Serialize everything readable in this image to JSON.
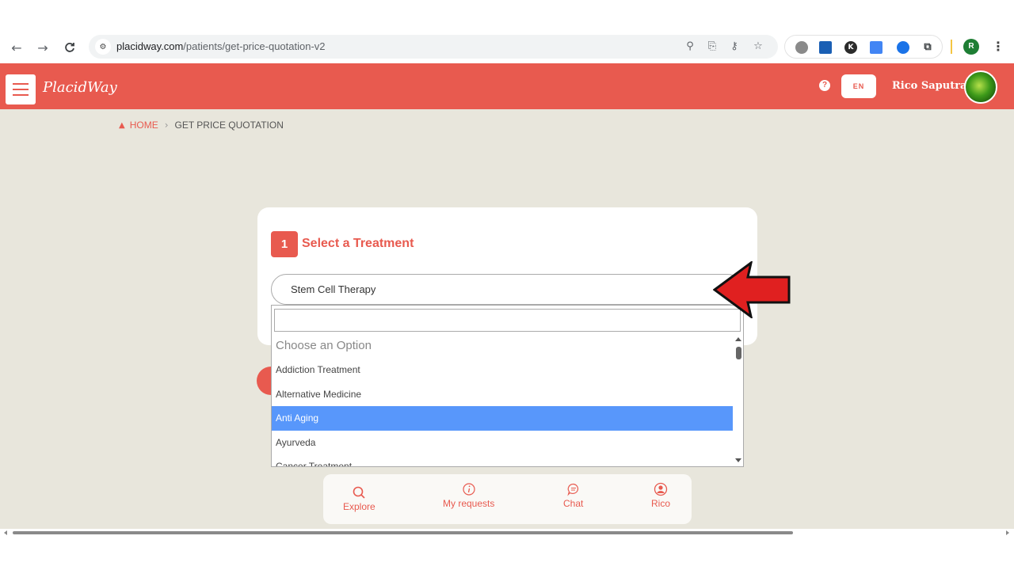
{
  "browser": {
    "url_host": "placidway.com",
    "url_path": "/patients/get-price-quotation-v2",
    "profile_initial": "R",
    "extensions": [
      {
        "name": "globe-extension-icon",
        "color": "#8a8a8a",
        "label": ""
      },
      {
        "name": "pen-extension-icon",
        "color": "#1a5fb4",
        "label": ""
      },
      {
        "name": "k-extension-icon",
        "color": "#2b2b2b",
        "label": "K"
      },
      {
        "name": "translate-extension-icon",
        "color": "#4285f4",
        "label": ""
      },
      {
        "name": "triangle-extension-icon",
        "color": "#1a73e8",
        "label": ""
      },
      {
        "name": "puzzle-extension-icon",
        "color": "#5f6368",
        "label": ""
      }
    ]
  },
  "header": {
    "logo_text": "PlacidWay",
    "lang": "EN",
    "user_name": "Rico Saputra",
    "brand_color": "#e85a4f"
  },
  "breadcrumb": {
    "home": "HOME",
    "current": "GET PRICE QUOTATION"
  },
  "form": {
    "step_number": "1",
    "step_title": "Select a Treatment",
    "selected_value": "Stem Cell Therapy",
    "dropdown": {
      "search_value": "",
      "options": [
        "Choose an Option",
        "Addiction Treatment",
        "Alternative Medicine",
        "Anti Aging",
        "Ayurveda",
        "Cancer Treatment"
      ],
      "highlighted": "Anti Aging"
    }
  },
  "bottom_nav": {
    "items": [
      {
        "label": "Explore",
        "icon": "search-icon"
      },
      {
        "label": "My requests",
        "icon": "info-icon"
      },
      {
        "label": "Chat",
        "icon": "chat-icon"
      },
      {
        "label": "Rico",
        "icon": "user-icon"
      }
    ]
  }
}
